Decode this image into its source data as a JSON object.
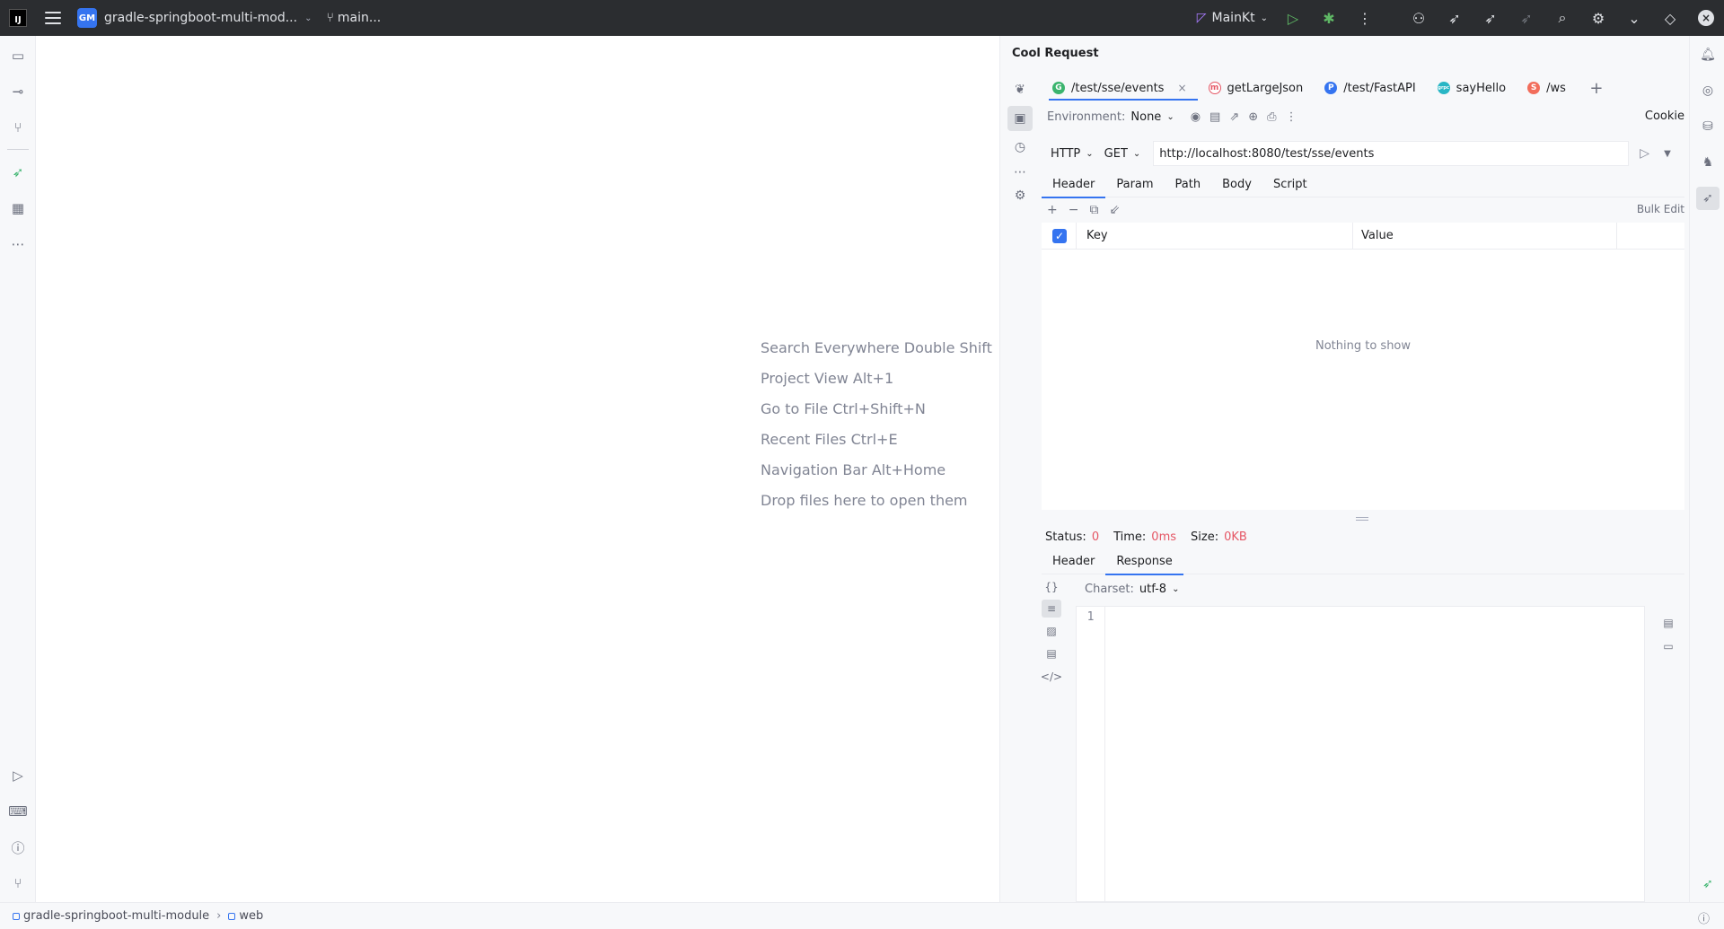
{
  "titlebar": {
    "logo_text": "IJ",
    "project_badge": "GM",
    "project_name": "gradle-springboot-multi-mod...",
    "branch": "main...",
    "run_config": "MainKt"
  },
  "editor_hints": [
    "Search Everywhere Double Shift",
    "Project View Alt+1",
    "Go to File Ctrl+Shift+N",
    "Recent Files Ctrl+E",
    "Navigation Bar Alt+Home",
    "Drop files here to open them"
  ],
  "panel": {
    "title": "Cool Request",
    "tabs": [
      {
        "label": "/test/sse/events",
        "badge": "G",
        "color": "#3bb46e",
        "active": true
      },
      {
        "label": "getLargeJson",
        "badge": "m",
        "color": "#e55765",
        "active": false
      },
      {
        "label": "/test/FastAPI",
        "badge": "P",
        "color": "#3574f0",
        "active": false
      },
      {
        "label": "sayHello",
        "badge": "grpc",
        "color": "#29b6c5",
        "active": false
      },
      {
        "label": "/ws",
        "badge": "S",
        "color": "#f26d5b",
        "active": false
      }
    ],
    "environment_label": "Environment:",
    "environment_value": "None",
    "cookie_label": "Cookie",
    "protocol": "HTTP",
    "method": "GET",
    "url": "http://localhost:8080/test/sse/events",
    "request_tabs": [
      "Header",
      "Param",
      "Path",
      "Body",
      "Script"
    ],
    "bulk_edit": "Bulk Edit",
    "table": {
      "key_header": "Key",
      "value_header": "Value",
      "empty_text": "Nothing to show"
    },
    "status": {
      "status_label": "Status:",
      "status_value": "0",
      "time_label": "Time:",
      "time_value": "0ms",
      "size_label": "Size:",
      "size_value": "0KB"
    },
    "response_tabs": [
      "Header",
      "Response"
    ],
    "charset_label": "Charset:",
    "charset_value": "utf-8",
    "line_number": "1"
  },
  "statusbar": {
    "project": "gradle-springboot-multi-module",
    "module": "web"
  },
  "colors": {
    "accent": "#3574f0",
    "titlebar": "#2b2d30",
    "error": "#e55765"
  }
}
